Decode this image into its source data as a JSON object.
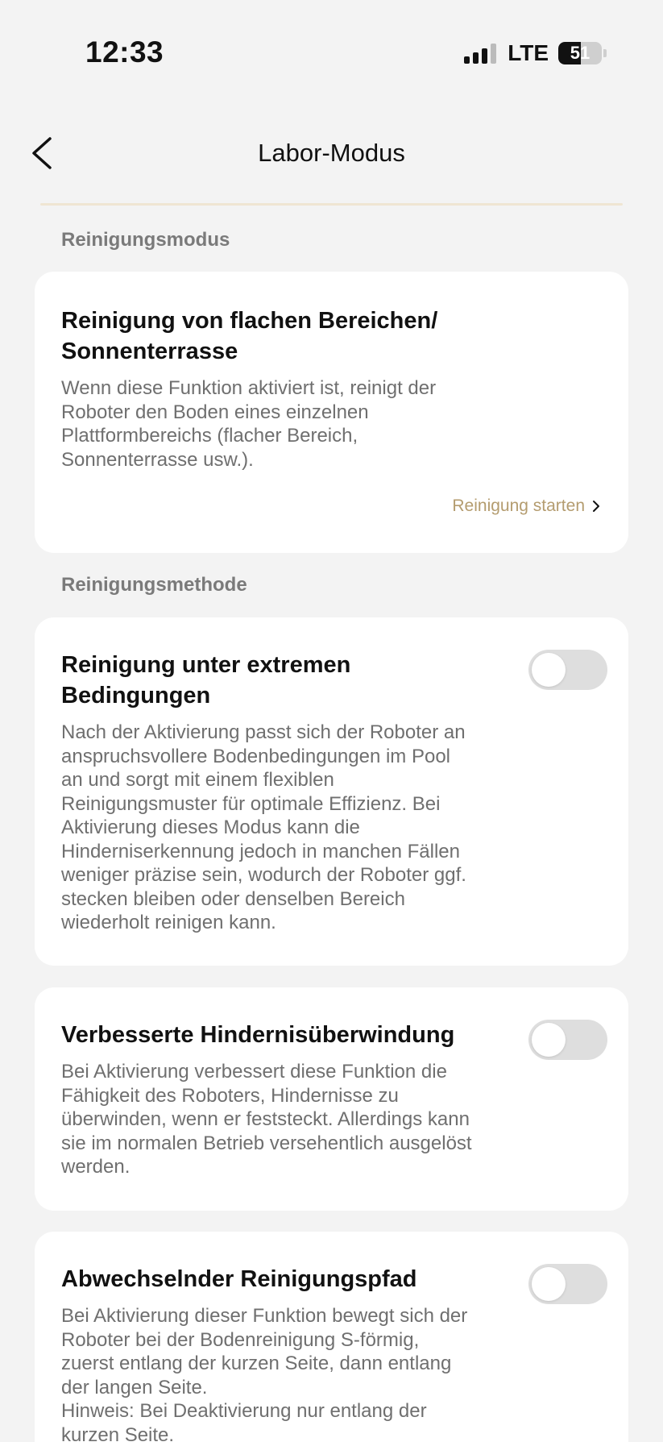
{
  "status_bar": {
    "time": "12:33",
    "network": "LTE",
    "battery_percent": 51,
    "battery_label": "51",
    "signal_bars": 4
  },
  "nav": {
    "title": "Labor-Modus",
    "back_icon": "chevron-left-icon"
  },
  "sections": {
    "cleaning_mode_label": "Reinigungsmodus",
    "cleaning_method_label": "Reinigungsmethode"
  },
  "flat_area_card": {
    "title_line1": "Reinigung von flachen Bereichen/",
    "title_line2": "Sonnenterrasse",
    "desc_lines": [
      "Wenn diese Funktion aktiviert ist, reinigt der",
      "Roboter den Boden eines einzelnen",
      "Plattformbereichs (flacher Bereich,",
      "Sonnenterrasse usw.)."
    ],
    "link_label": "Reinigung starten"
  },
  "extreme_card": {
    "title_line1": "Reinigung unter extremen",
    "title_line2": "Bedingungen",
    "enabled": false,
    "desc_lines": [
      "Nach der Aktivierung passt sich der Roboter an",
      "anspruchsvollere Bodenbedingungen im Pool",
      "an und sorgt mit einem flexiblen",
      "Reinigungsmuster für optimale Effizienz. Bei",
      "Aktivierung dieses Modus kann die",
      "Hinderniserkennung jedoch in manchen Fällen",
      "weniger präzise sein, wodurch der Roboter ggf.",
      "stecken bleiben oder denselben Bereich",
      "wiederholt reinigen kann."
    ]
  },
  "obstacle_card": {
    "title": "Verbesserte Hindernisüberwindung",
    "enabled": false,
    "desc_lines": [
      "Bei Aktivierung verbessert diese Funktion die",
      "Fähigkeit des Roboters, Hindernisse zu",
      "überwinden, wenn er feststeckt. Allerdings kann",
      "sie im normalen Betrieb versehentlich ausgelöst",
      "werden."
    ]
  },
  "path_card": {
    "title": "Abwechselnder Reinigungspfad",
    "enabled": false,
    "desc_lines": [
      "Bei Aktivierung dieser Funktion bewegt sich der",
      "Roboter bei der Bodenreinigung S-förmig,",
      "zuerst entlang der kurzen Seite, dann entlang",
      "der langen Seite.",
      "Hinweis: Bei Deaktivierung nur entlang der",
      "kurzen Seite."
    ]
  },
  "colors": {
    "background": "#f3f3f3",
    "card": "#ffffff",
    "accent_link": "#b49c6f",
    "toggle_off": "#dedede",
    "section_label": "#7a7a7a"
  }
}
